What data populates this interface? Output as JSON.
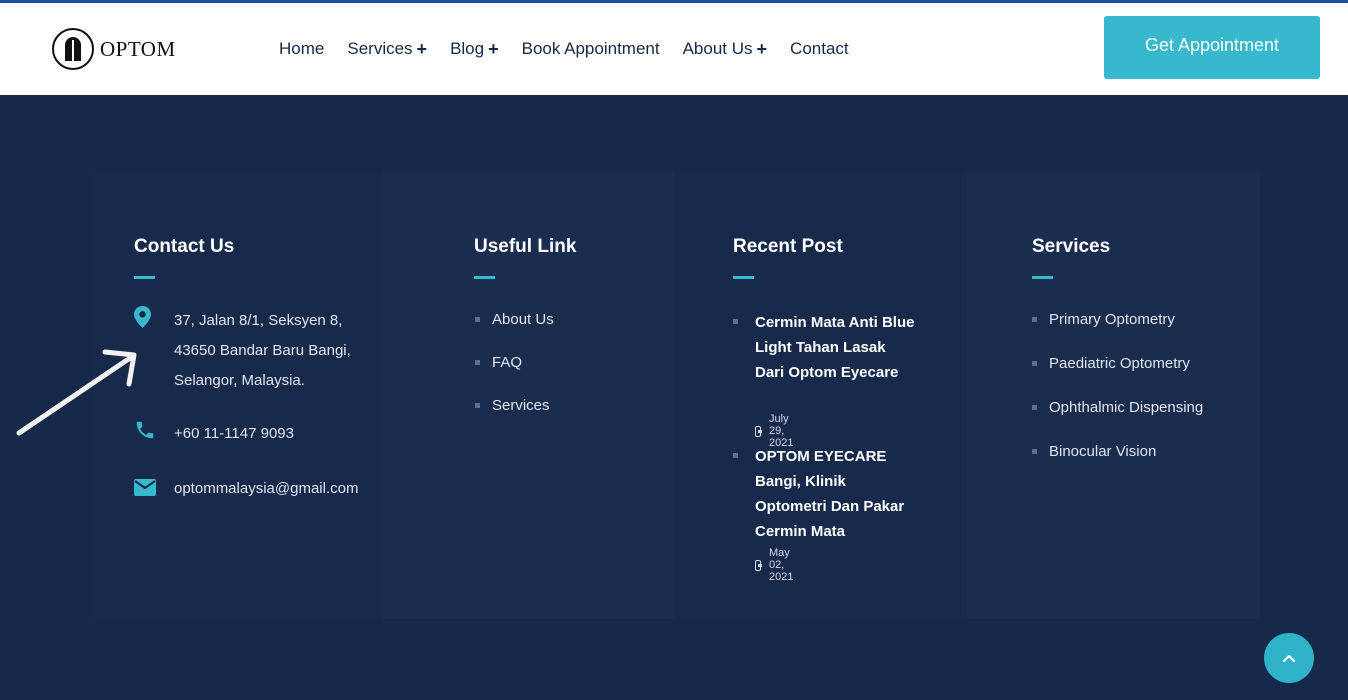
{
  "header": {
    "logo_text": "OPTOM",
    "nav": [
      {
        "label": "Home",
        "has_sub": false
      },
      {
        "label": "Services",
        "has_sub": true
      },
      {
        "label": "Blog",
        "has_sub": true
      },
      {
        "label": "Book Appointment",
        "has_sub": false
      },
      {
        "label": "About Us",
        "has_sub": true
      },
      {
        "label": "Contact",
        "has_sub": false
      }
    ],
    "plus_symbol": "+",
    "cta_label": "Get Appointment"
  },
  "footer": {
    "contact": {
      "title": "Contact Us",
      "address_lines": [
        "37, Jalan 8/1, Seksyen 8,",
        "43650 Bandar Baru Bangi,",
        "Selangor, Malaysia."
      ],
      "phone": "+60 11-1147 9093",
      "email": "optommalaysia@gmail.com"
    },
    "useful_links": {
      "title": "Useful Link",
      "items": [
        "About Us",
        "FAQ",
        "Services"
      ]
    },
    "recent_posts": {
      "title": "Recent Post",
      "items": [
        {
          "title": "Cermin Mata Anti Blue Light Tahan Lasak Dari Optom Eyecare",
          "date": "July 29, 2021"
        },
        {
          "title": "OPTOM EYECARE Bangi, Klinik Optometri Dan Pakar Cermin Mata",
          "date": "May 02, 2021"
        }
      ]
    },
    "services": {
      "title": "Services",
      "items": [
        "Primary Optometry",
        "Paediatric Optometry",
        "Ophthalmic Dispensing",
        "Binocular Vision"
      ]
    }
  },
  "colors": {
    "accent": "#38b8cf",
    "footer_bg": "#16294a",
    "nav_text": "#16294a"
  },
  "icons": {
    "location": "map-pin-icon",
    "phone": "phone-icon",
    "email": "envelope-icon",
    "calendar": "calendar-icon",
    "scroll_top": "chevron-up-icon",
    "annotation": "arrow-icon"
  }
}
